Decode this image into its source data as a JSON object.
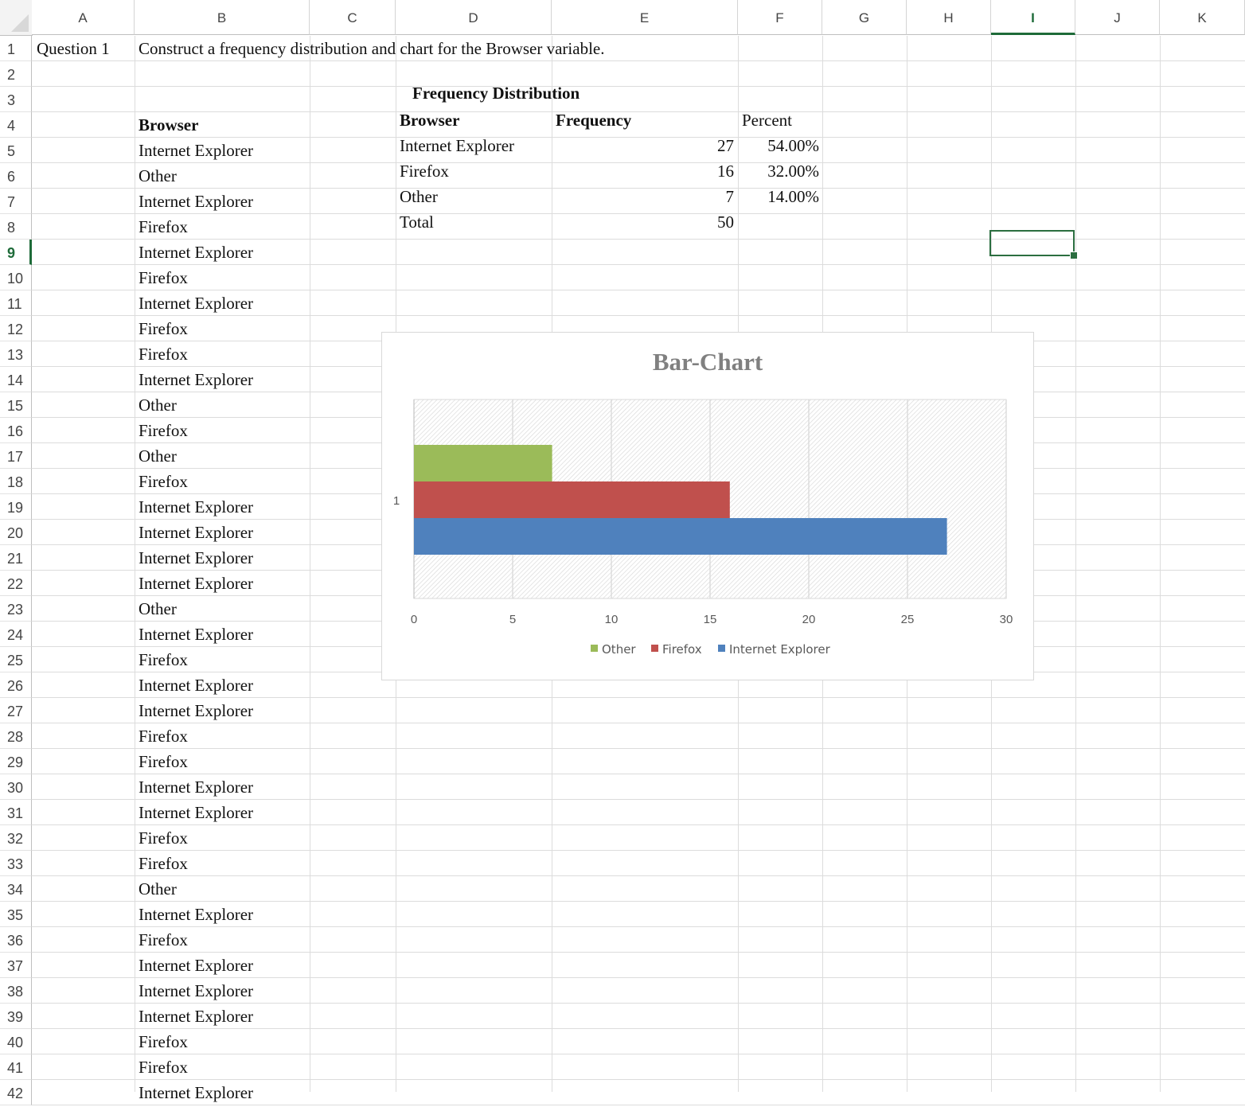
{
  "columns": [
    "A",
    "B",
    "C",
    "D",
    "E",
    "F",
    "G",
    "H",
    "I",
    "J",
    "K"
  ],
  "selected_column": "I",
  "rows": [
    "1",
    "2",
    "3",
    "4",
    "5",
    "6",
    "7",
    "8",
    "9",
    "10",
    "11",
    "12",
    "13",
    "14",
    "15",
    "16",
    "17",
    "18",
    "19",
    "20",
    "21",
    "22",
    "23",
    "24",
    "25",
    "26",
    "27",
    "28",
    "29",
    "30",
    "31",
    "32",
    "33",
    "34",
    "35",
    "36",
    "37",
    "38",
    "39",
    "40",
    "41",
    "42"
  ],
  "selected_row": "9",
  "question": {
    "label": "Question 1",
    "text": "Construct  a frequency distribution and chart for the Browser variable."
  },
  "data_column": {
    "header": "Browser",
    "values": [
      "Internet Explorer",
      "Other",
      "Internet Explorer",
      "Firefox",
      "Internet Explorer",
      "Firefox",
      "Internet Explorer",
      "Firefox",
      "Firefox",
      "Internet Explorer",
      "Other",
      "Firefox",
      "Other",
      "Firefox",
      "Internet Explorer",
      "Internet Explorer",
      "Internet Explorer",
      "Internet Explorer",
      "Other",
      "Internet Explorer",
      "Firefox",
      "Internet Explorer",
      "Internet Explorer",
      "Firefox",
      "Firefox",
      "Internet Explorer",
      "Internet Explorer",
      "Firefox",
      "Firefox",
      "Other",
      "Internet Explorer",
      "Firefox",
      "Internet Explorer",
      "Internet Explorer",
      "Internet Explorer",
      "Firefox",
      "Firefox",
      "Internet Explorer"
    ]
  },
  "frequency_table": {
    "title": "Frequency Distribution",
    "headers": {
      "browser": "Browser",
      "frequency": "Frequency",
      "percent": "Percent"
    },
    "rows": [
      {
        "browser": "Internet Explorer",
        "frequency": "27",
        "percent": "54.00%"
      },
      {
        "browser": "Firefox",
        "frequency": "16",
        "percent": "32.00%"
      },
      {
        "browser": "Other",
        "frequency": "7",
        "percent": "14.00%"
      }
    ],
    "total": {
      "label": "Total",
      "frequency": "50"
    }
  },
  "chart_data": {
    "type": "bar",
    "orientation": "horizontal",
    "title": "Bar-Chart",
    "categories": [
      "1"
    ],
    "series": [
      {
        "name": "Other",
        "values": [
          7
        ],
        "color": "#9bbb59"
      },
      {
        "name": "Firefox",
        "values": [
          16
        ],
        "color": "#c0504d"
      },
      {
        "name": "Internet Explorer",
        "values": [
          27
        ],
        "color": "#4f81bd"
      }
    ],
    "xlim": [
      0,
      30
    ],
    "xticks": [
      0,
      5,
      10,
      15,
      20,
      25,
      30
    ],
    "xtick_labels": [
      "0",
      "5",
      "10",
      "15",
      "20",
      "25",
      "30"
    ],
    "grid": true,
    "legend": "bottom"
  }
}
